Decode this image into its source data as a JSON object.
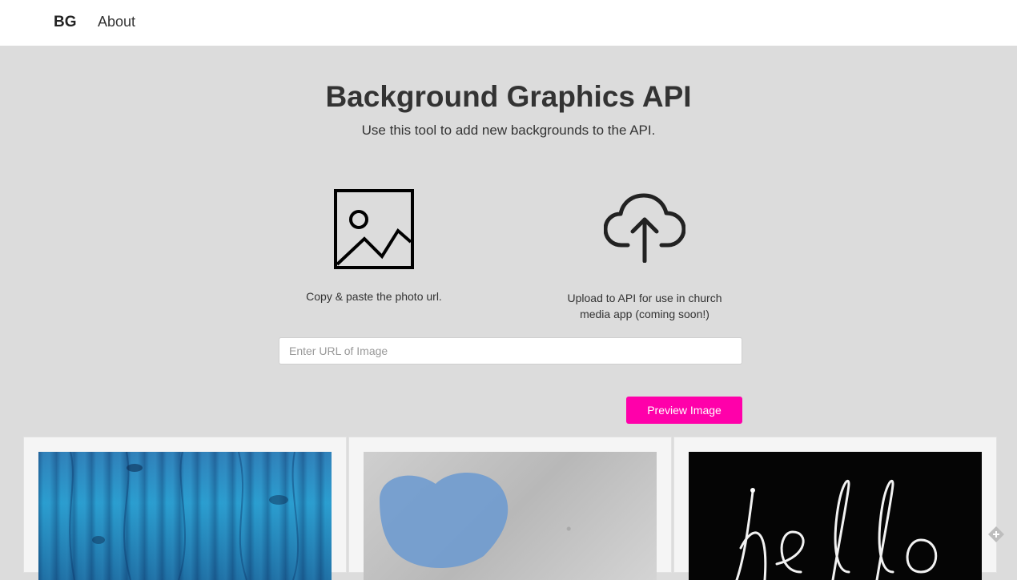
{
  "nav": {
    "brand": "BG",
    "about": "About"
  },
  "hero": {
    "title": "Background Graphics API",
    "subtitle": "Use this tool to add new backgrounds to the API."
  },
  "features": [
    {
      "icon": "image-icon",
      "caption": "Copy & paste the photo url."
    },
    {
      "icon": "cloud-upload-icon",
      "caption": "Upload to API for use in church media app (coming soon!)"
    }
  ],
  "form": {
    "url_placeholder": "Enter URL of Image",
    "url_value": "",
    "preview_label": "Preview Image"
  },
  "gallery": [
    {
      "name": "blue-wood-image"
    },
    {
      "name": "concrete-heart-image"
    },
    {
      "name": "hello-light-image"
    }
  ],
  "colors": {
    "accent": "#ff00aa",
    "page_bg": "#dcdcdc",
    "nav_bg": "#ffffff"
  }
}
